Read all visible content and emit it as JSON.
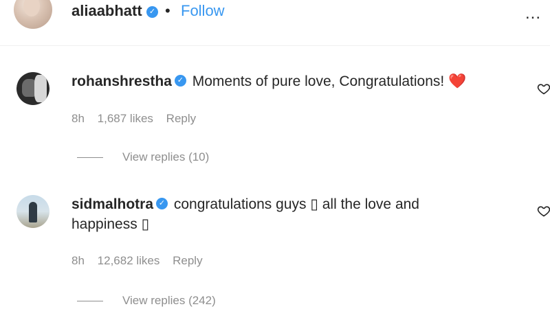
{
  "header": {
    "username": "aliaabhatt",
    "separator": "•",
    "follow_label": "Follow",
    "more_label": "..."
  },
  "comments": [
    {
      "username": "rohanshrestha",
      "text": "Moments of pure love, Congratulations! ❤️",
      "time": "8h",
      "likes": "1,687 likes",
      "reply_label": "Reply",
      "view_replies": "View replies (10)"
    },
    {
      "username": "sidmalhotra",
      "text_line1": "congratulations guys ▯ all the love and",
      "text_line2": "happiness ▯",
      "time": "8h",
      "likes": "12,682 likes",
      "reply_label": "Reply",
      "view_replies": "View replies (242)"
    }
  ],
  "colors": {
    "accent": "#3897f0",
    "text": "#262626",
    "muted": "#8e8e8e"
  },
  "icons": [
    "verified-badge-icon",
    "more-options-icon",
    "heart-outline-icon"
  ]
}
